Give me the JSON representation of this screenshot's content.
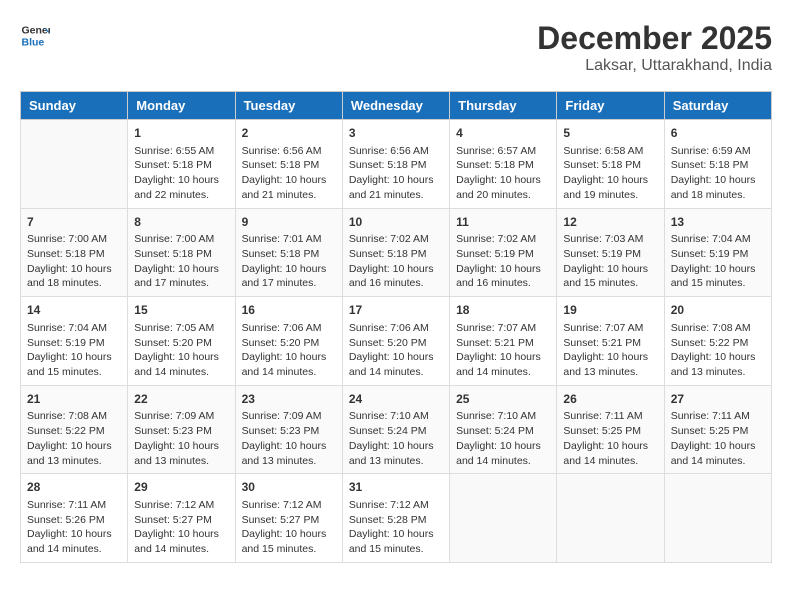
{
  "header": {
    "logo_line1": "General",
    "logo_line2": "Blue",
    "title": "December 2025",
    "subtitle": "Laksar, Uttarakhand, India"
  },
  "days_of_week": [
    "Sunday",
    "Monday",
    "Tuesday",
    "Wednesday",
    "Thursday",
    "Friday",
    "Saturday"
  ],
  "weeks": [
    [
      {
        "day": "",
        "info": ""
      },
      {
        "day": "1",
        "info": "Sunrise: 6:55 AM\nSunset: 5:18 PM\nDaylight: 10 hours\nand 22 minutes."
      },
      {
        "day": "2",
        "info": "Sunrise: 6:56 AM\nSunset: 5:18 PM\nDaylight: 10 hours\nand 21 minutes."
      },
      {
        "day": "3",
        "info": "Sunrise: 6:56 AM\nSunset: 5:18 PM\nDaylight: 10 hours\nand 21 minutes."
      },
      {
        "day": "4",
        "info": "Sunrise: 6:57 AM\nSunset: 5:18 PM\nDaylight: 10 hours\nand 20 minutes."
      },
      {
        "day": "5",
        "info": "Sunrise: 6:58 AM\nSunset: 5:18 PM\nDaylight: 10 hours\nand 19 minutes."
      },
      {
        "day": "6",
        "info": "Sunrise: 6:59 AM\nSunset: 5:18 PM\nDaylight: 10 hours\nand 18 minutes."
      }
    ],
    [
      {
        "day": "7",
        "info": "Sunrise: 7:00 AM\nSunset: 5:18 PM\nDaylight: 10 hours\nand 18 minutes."
      },
      {
        "day": "8",
        "info": "Sunrise: 7:00 AM\nSunset: 5:18 PM\nDaylight: 10 hours\nand 17 minutes."
      },
      {
        "day": "9",
        "info": "Sunrise: 7:01 AM\nSunset: 5:18 PM\nDaylight: 10 hours\nand 17 minutes."
      },
      {
        "day": "10",
        "info": "Sunrise: 7:02 AM\nSunset: 5:18 PM\nDaylight: 10 hours\nand 16 minutes."
      },
      {
        "day": "11",
        "info": "Sunrise: 7:02 AM\nSunset: 5:19 PM\nDaylight: 10 hours\nand 16 minutes."
      },
      {
        "day": "12",
        "info": "Sunrise: 7:03 AM\nSunset: 5:19 PM\nDaylight: 10 hours\nand 15 minutes."
      },
      {
        "day": "13",
        "info": "Sunrise: 7:04 AM\nSunset: 5:19 PM\nDaylight: 10 hours\nand 15 minutes."
      }
    ],
    [
      {
        "day": "14",
        "info": "Sunrise: 7:04 AM\nSunset: 5:19 PM\nDaylight: 10 hours\nand 15 minutes."
      },
      {
        "day": "15",
        "info": "Sunrise: 7:05 AM\nSunset: 5:20 PM\nDaylight: 10 hours\nand 14 minutes."
      },
      {
        "day": "16",
        "info": "Sunrise: 7:06 AM\nSunset: 5:20 PM\nDaylight: 10 hours\nand 14 minutes."
      },
      {
        "day": "17",
        "info": "Sunrise: 7:06 AM\nSunset: 5:20 PM\nDaylight: 10 hours\nand 14 minutes."
      },
      {
        "day": "18",
        "info": "Sunrise: 7:07 AM\nSunset: 5:21 PM\nDaylight: 10 hours\nand 14 minutes."
      },
      {
        "day": "19",
        "info": "Sunrise: 7:07 AM\nSunset: 5:21 PM\nDaylight: 10 hours\nand 13 minutes."
      },
      {
        "day": "20",
        "info": "Sunrise: 7:08 AM\nSunset: 5:22 PM\nDaylight: 10 hours\nand 13 minutes."
      }
    ],
    [
      {
        "day": "21",
        "info": "Sunrise: 7:08 AM\nSunset: 5:22 PM\nDaylight: 10 hours\nand 13 minutes."
      },
      {
        "day": "22",
        "info": "Sunrise: 7:09 AM\nSunset: 5:23 PM\nDaylight: 10 hours\nand 13 minutes."
      },
      {
        "day": "23",
        "info": "Sunrise: 7:09 AM\nSunset: 5:23 PM\nDaylight: 10 hours\nand 13 minutes."
      },
      {
        "day": "24",
        "info": "Sunrise: 7:10 AM\nSunset: 5:24 PM\nDaylight: 10 hours\nand 13 minutes."
      },
      {
        "day": "25",
        "info": "Sunrise: 7:10 AM\nSunset: 5:24 PM\nDaylight: 10 hours\nand 14 minutes."
      },
      {
        "day": "26",
        "info": "Sunrise: 7:11 AM\nSunset: 5:25 PM\nDaylight: 10 hours\nand 14 minutes."
      },
      {
        "day": "27",
        "info": "Sunrise: 7:11 AM\nSunset: 5:25 PM\nDaylight: 10 hours\nand 14 minutes."
      }
    ],
    [
      {
        "day": "28",
        "info": "Sunrise: 7:11 AM\nSunset: 5:26 PM\nDaylight: 10 hours\nand 14 minutes."
      },
      {
        "day": "29",
        "info": "Sunrise: 7:12 AM\nSunset: 5:27 PM\nDaylight: 10 hours\nand 14 minutes."
      },
      {
        "day": "30",
        "info": "Sunrise: 7:12 AM\nSunset: 5:27 PM\nDaylight: 10 hours\nand 15 minutes."
      },
      {
        "day": "31",
        "info": "Sunrise: 7:12 AM\nSunset: 5:28 PM\nDaylight: 10 hours\nand 15 minutes."
      },
      {
        "day": "",
        "info": ""
      },
      {
        "day": "",
        "info": ""
      },
      {
        "day": "",
        "info": ""
      }
    ]
  ]
}
